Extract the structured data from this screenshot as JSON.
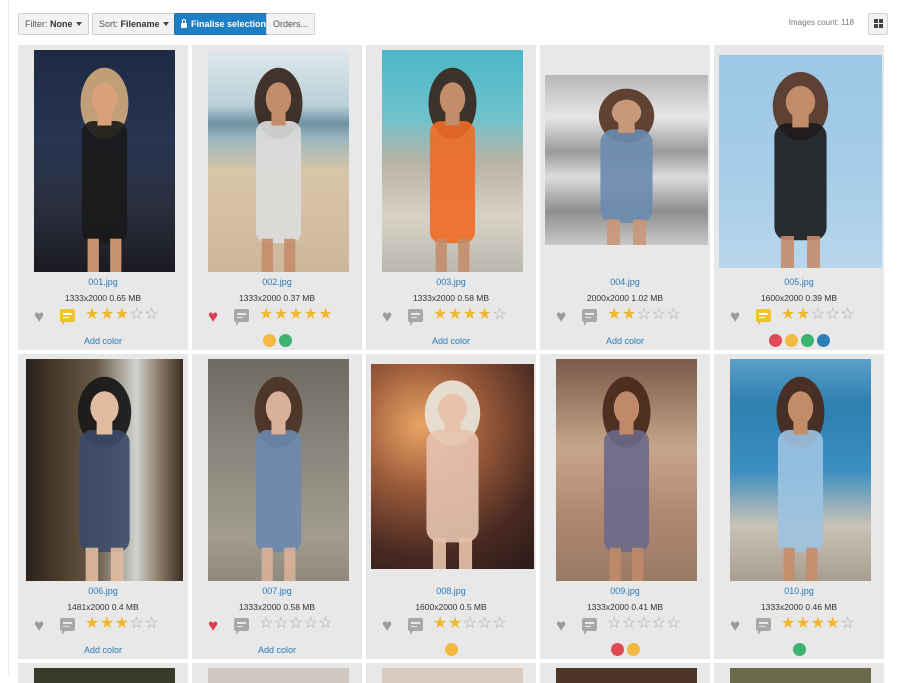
{
  "toolbar": {
    "filter_label": "Filter:",
    "filter_value": "None",
    "sort_label": "Sort:",
    "sort_value": "Filename",
    "finalise_label": "Finalise selection",
    "orders_label": "Orders...",
    "images_count_label": "Images count:",
    "images_count_value": "118"
  },
  "images": [
    {
      "name": "001.jpg",
      "dims": "1333x2000",
      "size": "0.65 MB",
      "fav": false,
      "comment": true,
      "rating": 3,
      "colors": [],
      "add_color": "Add color",
      "photo": {
        "bg": "linear-gradient(180deg,#1e2a44 0%,#273552 40%,#2a2f3d 70%,#1a1a22 100%)",
        "skin": "#d9a07a",
        "hair": "#c9a57a",
        "top": "#1a1a1a"
      }
    },
    {
      "name": "002.jpg",
      "dims": "1333x2000",
      "size": "0.37 MB",
      "fav": true,
      "comment": false,
      "rating": 5,
      "colors": [
        "#f4b942",
        "#3cb371"
      ],
      "add_color": "",
      "photo": {
        "bg": "linear-gradient(180deg,#dfe8ec 0%,#b9cfd8 25%,#6d93a4 33%,#9db6bf 40%,#d8c6a8 55%,#cdb79a 100%)",
        "skin": "#c48d6a",
        "hair": "#3a2a22",
        "top": "#ddd"
      }
    },
    {
      "name": "003.jpg",
      "dims": "1333x2000",
      "size": "0.58 MB",
      "fav": false,
      "comment": false,
      "rating": 4,
      "colors": [],
      "add_color": "Add color",
      "photo": {
        "bg": "linear-gradient(180deg,#4bb6c7 0%,#6ec3cd 30%,#b8b2a6 50%,#d8d2c6 75%,#bcb7ae 100%)",
        "skin": "#c48d6a",
        "hair": "#3a2a22",
        "top": "#f06a24"
      }
    },
    {
      "name": "004.jpg",
      "dims": "2000x2000",
      "size": "1.02 MB",
      "fav": false,
      "comment": false,
      "rating": 2,
      "colors": [],
      "add_color": "Add color",
      "photo": {
        "bg": "linear-gradient(180deg,#b8b8b8 0%,#e6e6e6 25%,#9a9a9a 45%,#dcdcdc 60%,#8e8e8e 80%,#c8c8c8 100%)",
        "skin": "#c9977a",
        "hair": "#5a3a2a",
        "top": "#6a8bb0"
      }
    },
    {
      "name": "005.jpg",
      "dims": "1600x2000",
      "size": "0.39 MB",
      "fav": false,
      "comment": true,
      "rating": 2,
      "colors": [
        "#e04a55",
        "#f4b942",
        "#3cb371",
        "#2c7fb8"
      ],
      "add_color": "",
      "photo": {
        "bg": "linear-gradient(180deg,#9bc7e6 0%,#a7cde8 60%,#b8d6ec 100%)",
        "skin": "#c48d6a",
        "hair": "#5a3a2a",
        "top": "#1a1a1a"
      }
    },
    {
      "name": "006.jpg",
      "dims": "1481x2000",
      "size": "0.4 MB",
      "fav": false,
      "comment": false,
      "rating": 3,
      "colors": [],
      "add_color": "Add color",
      "photo": {
        "bg": "linear-gradient(90deg,#2a221c 0%,#4a3a2a 20%,#6a5a48 45%,#cfd2cf 70%,#8a7a66 85%,#3a2c22 100%)",
        "skin": "#e0bba0",
        "hair": "#1a1a1a",
        "top": "#3c4a6a"
      }
    },
    {
      "name": "007.jpg",
      "dims": "1333x2000",
      "size": "0.58 MB",
      "fav": true,
      "comment": false,
      "rating": 0,
      "colors": [],
      "add_color": "Add color",
      "photo": {
        "bg": "linear-gradient(180deg,#6f6a60 0%,#8a857a 40%,#a29c90 80%,#908a7e 100%)",
        "skin": "#d9b098",
        "hair": "#4a3426",
        "top": "#6a88ae"
      }
    },
    {
      "name": "008.jpg",
      "dims": "1600x2000",
      "size": "0.5 MB",
      "fav": false,
      "comment": false,
      "rating": 2,
      "colors": [
        "#f4b942"
      ],
      "add_color": "",
      "photo": {
        "bg": "radial-gradient(circle at 30% 30%,#e9a464 0%,#9a5a3a 35%,#4a2a22 70%,#2a1a18 100%)",
        "skin": "#e8c2aa",
        "hair": "#e8e2d6",
        "top": "#e6c3b0"
      }
    },
    {
      "name": "009.jpg",
      "dims": "1333x2000",
      "size": "0.41 MB",
      "fav": false,
      "comment": false,
      "rating": 0,
      "colors": [
        "#e04a55",
        "#f4b942"
      ],
      "add_color": "",
      "photo": {
        "bg": "linear-gradient(180deg,#7a5a4a 0%,#c7a58a 40%,#b08870 70%,#9a7a66 100%)",
        "skin": "#c08a6a",
        "hair": "#4a2a1e",
        "top": "#6a6a8a"
      }
    },
    {
      "name": "010.jpg",
      "dims": "1333x2000",
      "size": "0.46 MB",
      "fav": false,
      "comment": false,
      "rating": 4,
      "colors": [
        "#3cb371"
      ],
      "add_color": "",
      "photo": {
        "bg": "linear-gradient(180deg,#5aa0c8 0%,#2f7fb0 20%,#3a8ec0 50%,#c9c2b6 75%,#a89e90 100%)",
        "skin": "#c48d6a",
        "hair": "#4a2a1e",
        "top": "#9cc3e2"
      }
    }
  ]
}
